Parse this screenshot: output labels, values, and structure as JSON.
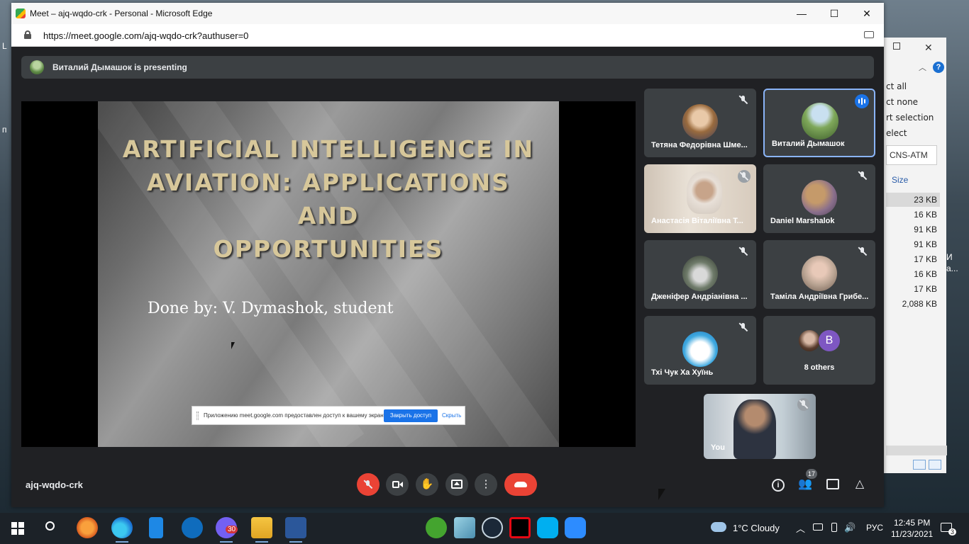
{
  "window": {
    "title": "Meet – ajq-wqdo-crk - Personal - Microsoft Edge",
    "minimize": "—",
    "maximize": "☐",
    "close": "✕"
  },
  "address_bar": {
    "url": "https://meet.google.com/ajq-wqdo-crk?authuser=0"
  },
  "presenting": {
    "text": "Виталий Дымашок is presenting"
  },
  "slide": {
    "title_lines": [
      "ARTIFICIAL INTELLIGENCE IN",
      "AVIATION: APPLICATIONS",
      "AND",
      "OPPORTUNITIES"
    ],
    "subtitle": "Done by: V. Dymashok, student"
  },
  "share_notice": {
    "text": "Приложению meet.google.com предоставлен доступ к вашему экрану.",
    "stop_button": "Закрыть доступ",
    "hide_link": "Скрыть"
  },
  "participants": [
    {
      "name": "Тетяна Федорівна Шме...",
      "muted": true
    },
    {
      "name": "Виталий Дымашок",
      "speaking": true
    },
    {
      "name": "Анастасія Віталіївна Т...",
      "muted": true
    },
    {
      "name": "Daniel Marshalok",
      "muted": true
    },
    {
      "name": "Дженіфер Андріанівна ...",
      "muted": true
    },
    {
      "name": "Таміла Андріївна Грибе...",
      "muted": true
    },
    {
      "name": "Тхі Чук Ха Хуїнь",
      "muted": true
    }
  ],
  "others": {
    "avatar_letter": "B",
    "label": "8 others"
  },
  "self_tile": {
    "name": "You"
  },
  "meeting_code": "ajq-wqdo-crk",
  "people_count": "17",
  "explorer": {
    "commands": [
      "ct all",
      "ct none",
      "rt selection",
      "elect"
    ],
    "path": "CNS-ATM",
    "size_header": "Size",
    "sizes": [
      "23 KB",
      "16 KB",
      "91 KB",
      "91 KB",
      "17 KB",
      "16 KB",
      "17 KB",
      "2,088 KB"
    ],
    "help": "?"
  },
  "desktop_text": {
    "left_a": "L",
    "left_b": "п",
    "right_a": "И",
    "right_b": "а..."
  },
  "taskbar": {
    "weather": "1°C  Cloudy",
    "lang": "РУС",
    "time": "12:45 PM",
    "date": "11/23/2021",
    "viber_badge": "30",
    "notif_badge": "3"
  },
  "colors": {
    "meet_bg": "#202124",
    "tile_bg": "#3c4043",
    "red": "#ea4335",
    "accent": "#1a73e8"
  }
}
